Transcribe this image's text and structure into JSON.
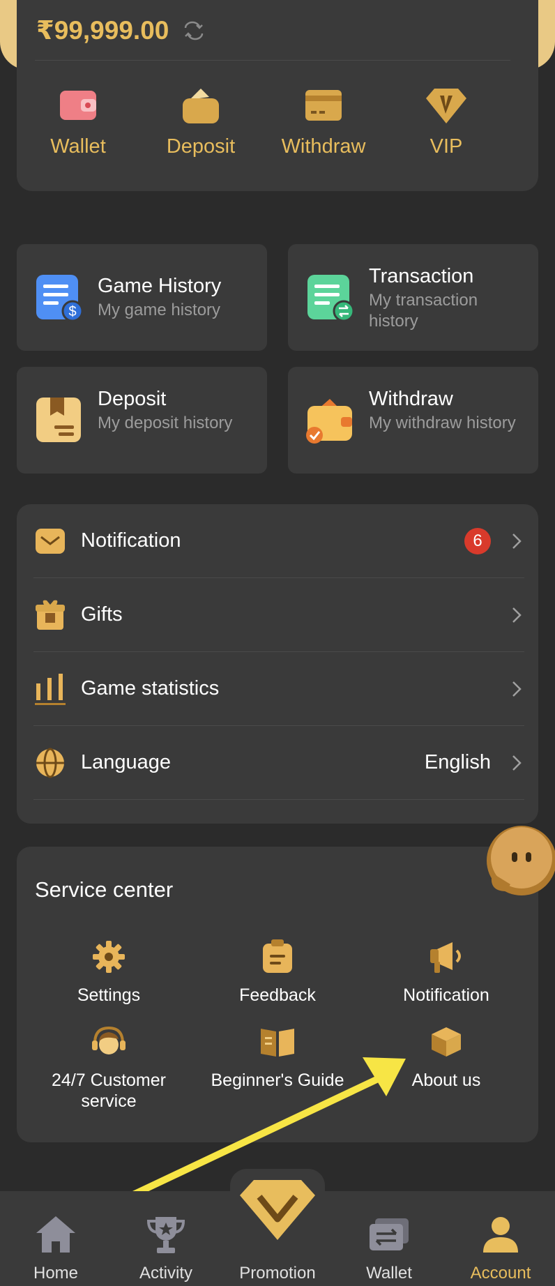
{
  "balance": {
    "amount": "₹99,999.00"
  },
  "quick_actions": [
    {
      "label": "Wallet",
      "icon": "wallet-icon"
    },
    {
      "label": "Deposit",
      "icon": "deposit-icon"
    },
    {
      "label": "Withdraw",
      "icon": "withdraw-icon"
    },
    {
      "label": "VIP",
      "icon": "vip-icon"
    }
  ],
  "history_cards": [
    {
      "title": "Game History",
      "subtitle": "My game history",
      "icon": "game-history-icon"
    },
    {
      "title": "Transaction",
      "subtitle": "My transaction history",
      "icon": "transaction-icon"
    },
    {
      "title": "Deposit",
      "subtitle": "My deposit history",
      "icon": "deposit-history-icon"
    },
    {
      "title": "Withdraw",
      "subtitle": "My withdraw history",
      "icon": "withdraw-history-icon"
    }
  ],
  "menu": [
    {
      "label": "Notification",
      "badge": "6",
      "icon": "mail-icon"
    },
    {
      "label": "Gifts",
      "icon": "gift-icon"
    },
    {
      "label": "Game statistics",
      "icon": "bar-chart-icon"
    },
    {
      "label": "Language",
      "value": "English",
      "icon": "globe-icon"
    }
  ],
  "service_center": {
    "title": "Service center",
    "items": [
      {
        "label": "Settings",
        "icon": "gear-icon"
      },
      {
        "label": "Feedback",
        "icon": "clipboard-icon"
      },
      {
        "label": "Notification",
        "icon": "megaphone-icon"
      },
      {
        "label": "24/7 Customer service",
        "icon": "headset-icon"
      },
      {
        "label": "Beginner's Guide",
        "icon": "book-icon"
      },
      {
        "label": "About us",
        "icon": "box-icon"
      }
    ]
  },
  "bottom_nav": [
    {
      "label": "Home",
      "icon": "home-icon"
    },
    {
      "label": "Activity",
      "icon": "trophy-icon"
    },
    {
      "label": "Promotion",
      "icon": "diamond-icon"
    },
    {
      "label": "Wallet",
      "icon": "wallet-nav-icon"
    },
    {
      "label": "Account",
      "icon": "user-icon",
      "active": true
    }
  ],
  "colors": {
    "accent": "#e8bd5d",
    "background": "#2b2b2b",
    "card": "#3a3a3a",
    "badge": "#d93a2b",
    "annotation_arrow": "#f7e545"
  }
}
